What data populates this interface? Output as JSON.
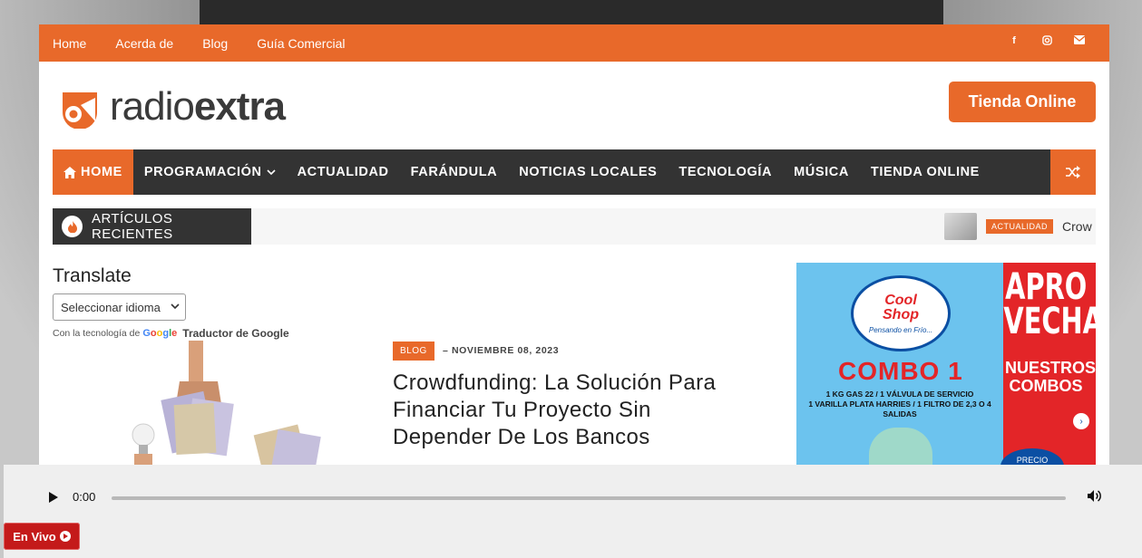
{
  "topbar": {
    "menu": [
      "Home",
      "Acerda de",
      "Blog",
      "Guía Comercial"
    ],
    "social_icons": [
      "facebook-icon",
      "instagram-icon",
      "mail-icon"
    ]
  },
  "header": {
    "logo_text_light": "radio",
    "logo_text_bold": "extra",
    "shop_button": "Tienda Online"
  },
  "mainnav": {
    "items": [
      "HOME",
      "PROGRAMACIÓN",
      "ACTUALIDAD",
      "FARÁNDULA",
      "NOTICIAS LOCALES",
      "TECNOLOGÍA",
      "MÚSICA",
      "TIENDA ONLINE"
    ],
    "active_index": 0
  },
  "recent": {
    "label": "ARTÍCULOS RECIENTES",
    "ticker_tag": "ACTUALIDAD",
    "ticker_title": "Crow"
  },
  "translate": {
    "title": "Translate",
    "select_value": "Seleccionar idioma",
    "powered_prefix": "Con la tecnología de",
    "powered_brand": "Google",
    "powered_suffix": "Traductor de Google"
  },
  "article": {
    "tag": "BLOG",
    "date": "NOVIEMBRE 08, 2023",
    "title": "Crowdfunding: La Solución Para Financiar Tu Proyecto Sin Depender De Los Bancos"
  },
  "ad": {
    "brand_line1": "Cool",
    "brand_line2": "Shop",
    "tagline": "Pensando en Frío...",
    "combo": "COMBO 1",
    "desc_line1": "1 KG GAS 22 / 1 VÁLVULA DE SERVICIO",
    "desc_line2": "1 VARILLA PLATA HARRIES / 1 FILTRO DE 2,3 O 4 SALIDAS",
    "headline": "APRO VECHA",
    "sub": "NUESTROS COMBOS",
    "precio": "PRECIO"
  },
  "player": {
    "time": "0:00",
    "progress": 0
  },
  "live_button": "En Vivo",
  "colors": {
    "accent": "#e8692a",
    "nav_bg": "#333333",
    "live_red": "#c41a1a"
  }
}
